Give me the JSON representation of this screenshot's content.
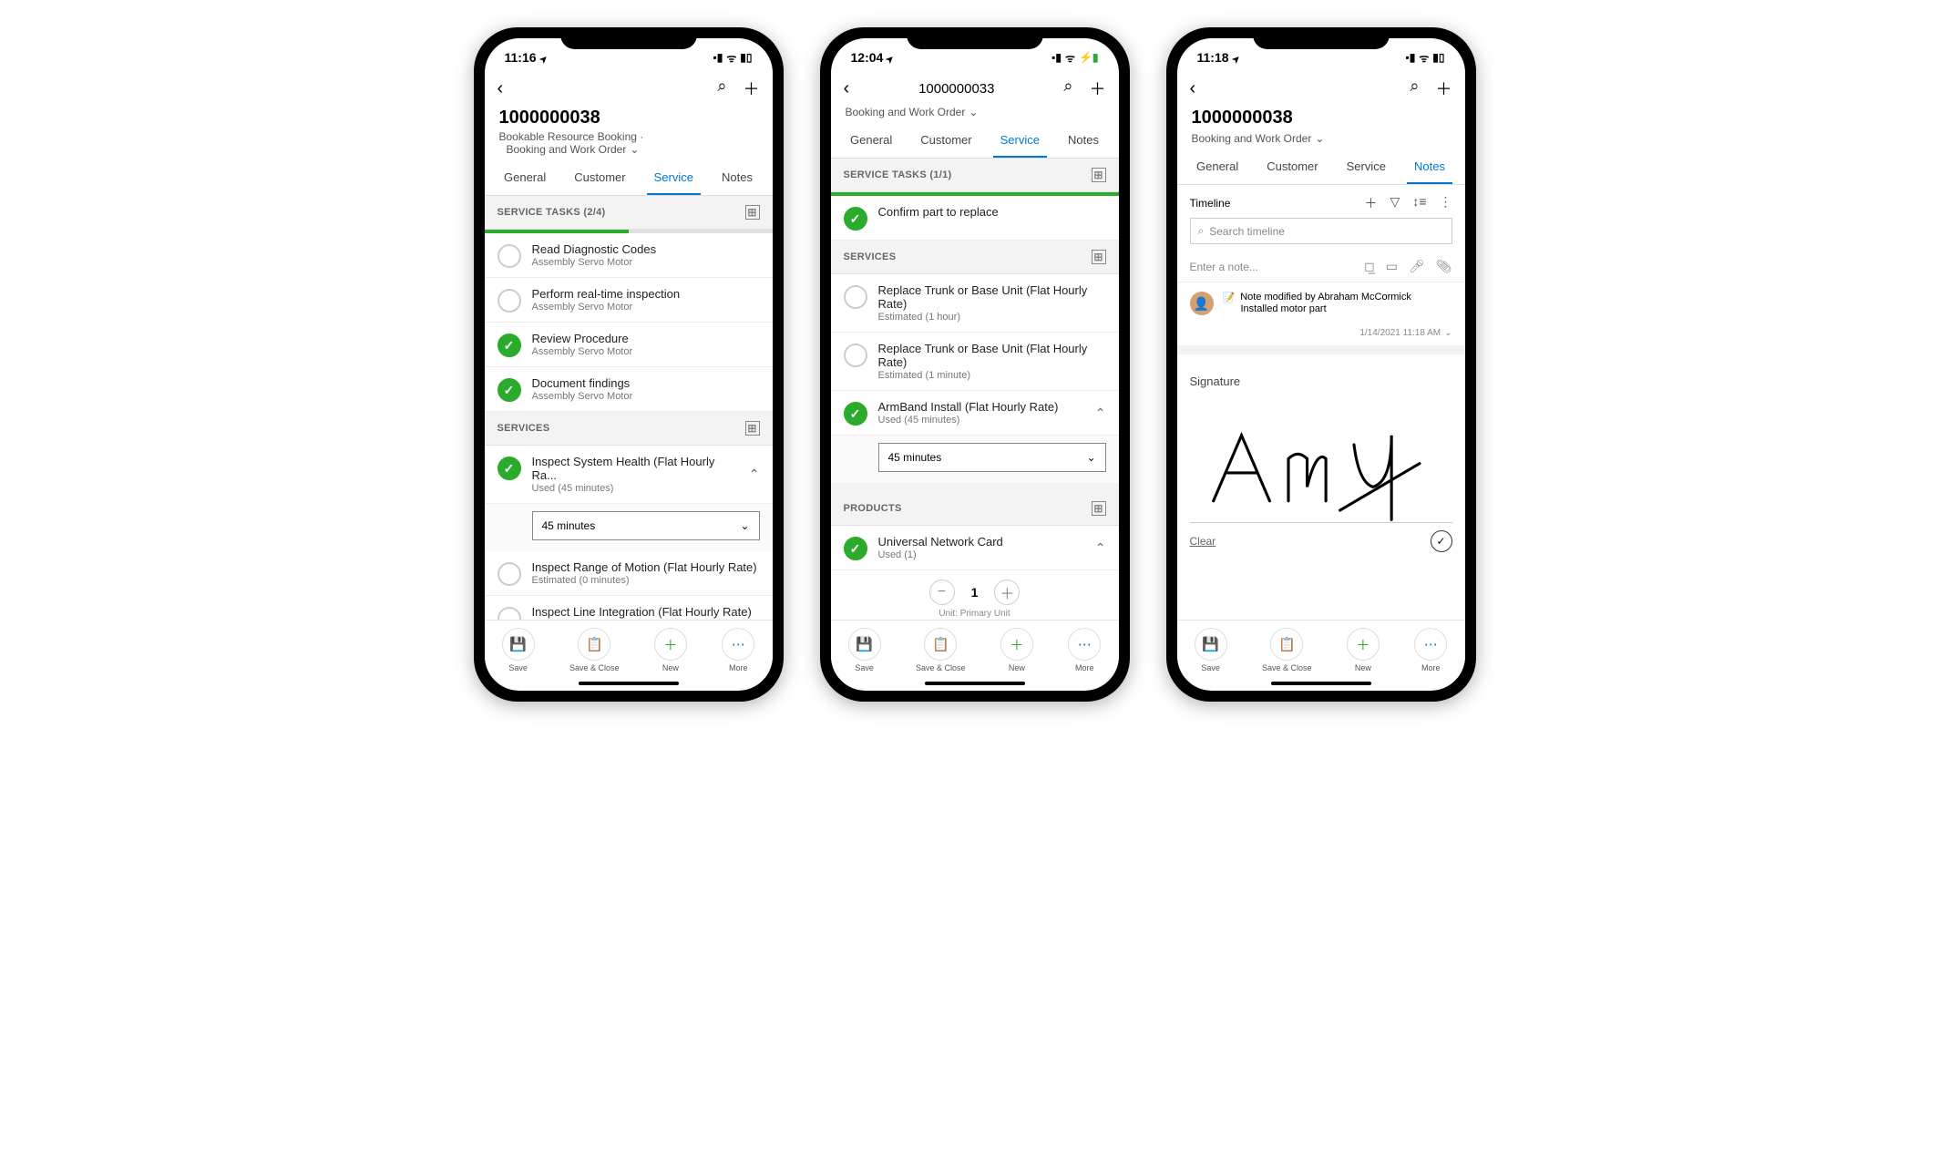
{
  "phone1": {
    "status": {
      "time": "11:16",
      "signal": "▪▪▪",
      "wifi": "◈",
      "battery": "■"
    },
    "title": "1000000038",
    "subtitle": "Bookable Resource Booking  ·",
    "dropdown": "Booking and Work Order",
    "tabs": [
      "General",
      "Customer",
      "Service",
      "Notes"
    ],
    "activeTab": "Service",
    "serviceTasksHeader": "SERVICE TASKS (2/4)",
    "progressPct": 50,
    "tasks": [
      {
        "title": "Read Diagnostic Codes",
        "sub": "Assembly Servo Motor",
        "done": false
      },
      {
        "title": "Perform real-time inspection",
        "sub": "Assembly Servo Motor",
        "done": false
      },
      {
        "title": "Review Procedure",
        "sub": "Assembly Servo Motor",
        "done": true
      },
      {
        "title": "Document findings",
        "sub": "Assembly Servo Motor",
        "done": true
      }
    ],
    "servicesHeader": "SERVICES",
    "services": [
      {
        "title": "Inspect System Health (Flat Hourly Ra...",
        "sub": "Used (45 minutes)",
        "done": true,
        "expanded": true,
        "dropdownVal": "45 minutes"
      },
      {
        "title": "Inspect Range of Motion (Flat Hourly Rate)",
        "sub": "Estimated (0 minutes)",
        "done": false
      },
      {
        "title": "Inspect Line Integration (Flat Hourly Rate)",
        "sub": "",
        "done": false
      }
    ]
  },
  "phone2": {
    "status": {
      "time": "12:04"
    },
    "headerTitle": "1000000033",
    "dropdown": "Booking and Work Order",
    "tabs": [
      "General",
      "Customer",
      "Service",
      "Notes"
    ],
    "activeTab": "Service",
    "serviceTasksHeader": "SERVICE TASKS (1/1)",
    "progressPct": 100,
    "tasks": [
      {
        "title": "Confirm part to replace",
        "sub": "",
        "done": true
      }
    ],
    "servicesHeader": "SERVICES",
    "services": [
      {
        "title": "Replace Trunk or Base Unit (Flat Hourly Rate)",
        "sub": "Estimated (1 hour)",
        "done": false
      },
      {
        "title": "Replace Trunk or Base Unit (Flat Hourly Rate)",
        "sub": "Estimated (1 minute)",
        "done": false
      },
      {
        "title": "ArmBand Install (Flat Hourly Rate)",
        "sub": "Used (45 minutes)",
        "done": true,
        "expanded": true,
        "dropdownVal": "45 minutes"
      }
    ],
    "productsHeader": "PRODUCTS",
    "products": [
      {
        "title": "Universal Network Card",
        "sub": "Used (1)",
        "done": true,
        "expanded": true,
        "qty": "1",
        "unitLabel": "Unit: Primary Unit"
      }
    ]
  },
  "phone3": {
    "status": {
      "time": "11:18"
    },
    "title": "1000000038",
    "dropdown": "Booking and Work Order",
    "tabs": [
      "General",
      "Customer",
      "Service",
      "Notes"
    ],
    "activeTab": "Notes",
    "timelineLabel": "Timeline",
    "searchPlaceholder": "Search timeline",
    "notePlaceholder": "Enter a note...",
    "noteTitle": "Note modified by Abraham McCormick",
    "noteBody": "Installed motor part",
    "noteDate": "1/14/2021 11:18 AM",
    "sigLabel": "Signature",
    "clearLabel": "Clear"
  },
  "bottomBar": {
    "save": "Save",
    "saveClose": "Save & Close",
    "new": "New",
    "more": "More"
  }
}
